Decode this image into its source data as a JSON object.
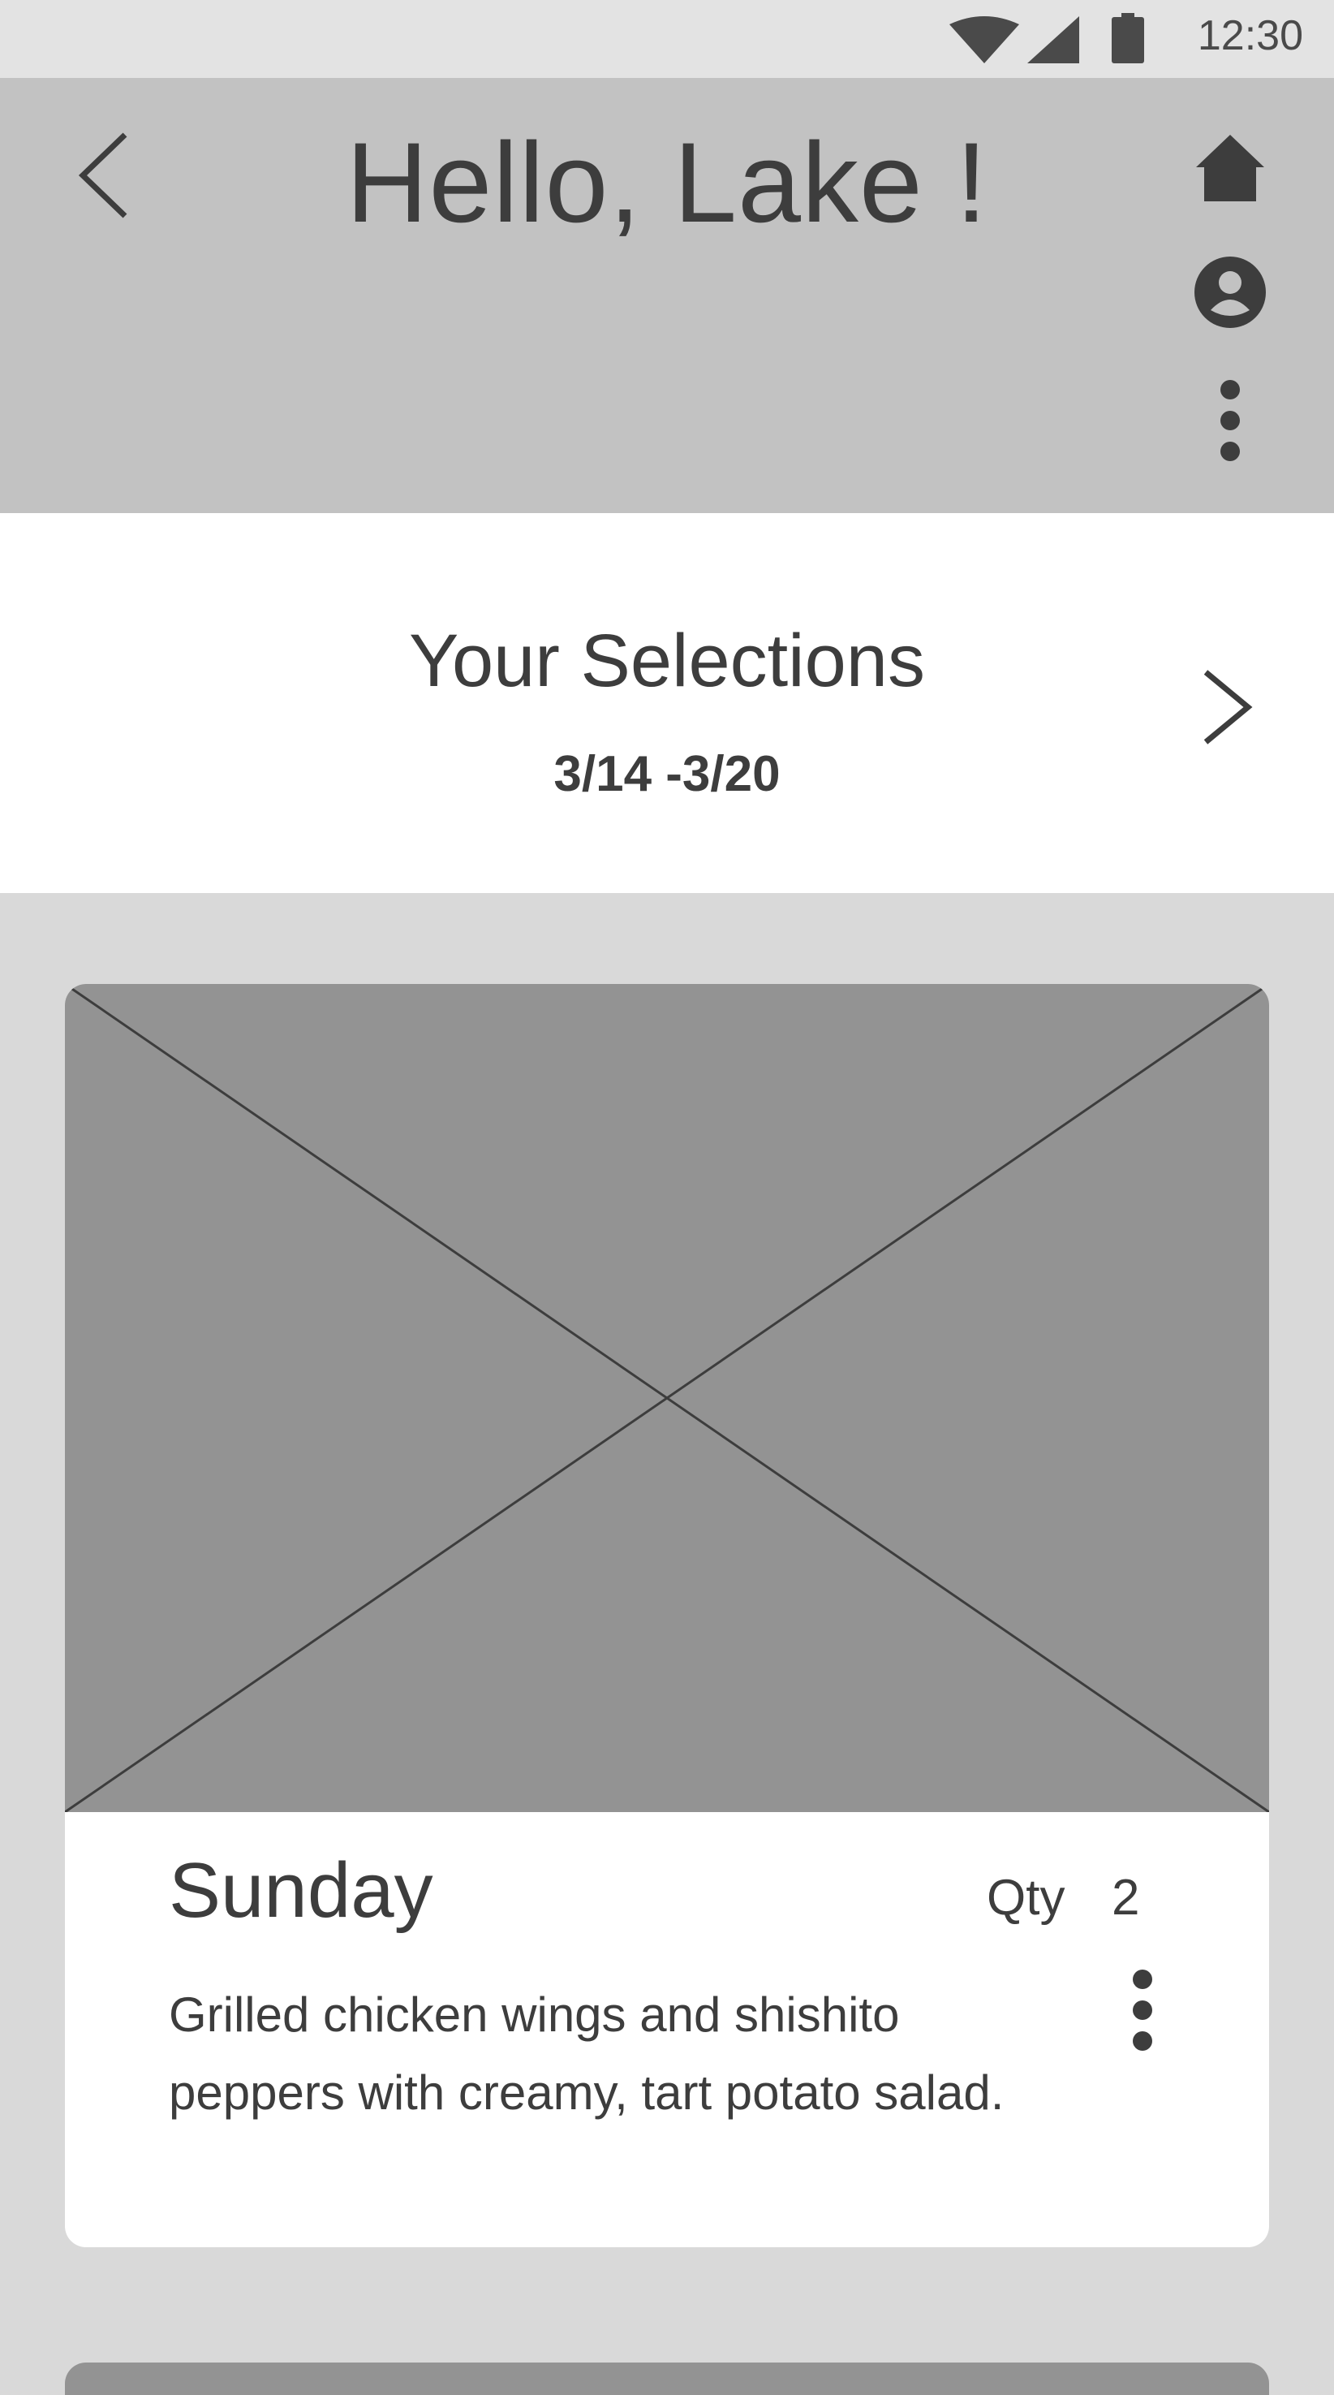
{
  "status_bar": {
    "time": "12:30",
    "icons": [
      "wifi-icon",
      "signal-icon",
      "battery-icon"
    ]
  },
  "app_bar": {
    "title": "Hello, Lake !",
    "icons": [
      "back-arrow-icon",
      "home-icon",
      "account-circle-icon",
      "more-vertical-icon"
    ]
  },
  "selections": {
    "title": "Your Selections",
    "date_range": "3/14 -3/20",
    "next_icon": "chevron-right-icon"
  },
  "meal_card": {
    "image_placeholder": "image-placeholder",
    "day": "Sunday",
    "qty_label": "Qty",
    "qty_value": "2",
    "description": "Grilled chicken wings and shishito peppers with creamy, tart potato salad.",
    "more_icon": "more-vertical-icon"
  },
  "colors": {
    "status_bar_bg": "#e3e3e3",
    "app_bar_bg": "#c2c2c2",
    "page_bg": "#d9d9d9",
    "card_bg": "#ffffff",
    "image_placeholder_bg": "#939393",
    "text": "#3d3d3d"
  }
}
